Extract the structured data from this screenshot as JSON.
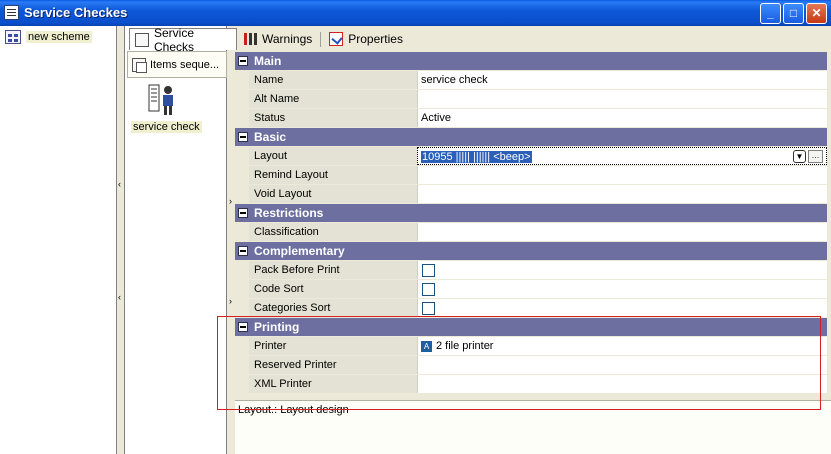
{
  "window": {
    "title": "Service Checkes",
    "buttons": {
      "minimize": "_",
      "maximize": "□",
      "close": "✕"
    }
  },
  "left_tree": {
    "items": [
      {
        "label": "new scheme"
      }
    ]
  },
  "middle": {
    "tab_service_checks": "Service Checks",
    "tab_items_sequence": "Items seque...",
    "item_label": "service check"
  },
  "tabs": {
    "warnings": "Warnings",
    "properties": "Properties"
  },
  "grid": {
    "main": {
      "title": "Main",
      "name_label": "Name",
      "name_value": "service check",
      "altname_label": "Alt Name",
      "altname_value": "",
      "status_label": "Status",
      "status_value": "Active"
    },
    "basic": {
      "title": "Basic",
      "layout_label": "Layout",
      "layout_value": "10955 ||||| |||||| <beep>",
      "remind_label": "Remind Layout",
      "remind_value": "",
      "void_label": "Void Layout",
      "void_value": ""
    },
    "restrictions": {
      "title": "Restrictions",
      "classification_label": "Classification",
      "classification_value": ""
    },
    "complementary": {
      "title": "Complementary",
      "pack_label": "Pack Before Print",
      "pack_checked": false,
      "code_label": "Code Sort",
      "code_checked": false,
      "categories_label": "Categories Sort",
      "categories_checked": false
    },
    "printing": {
      "title": "Printing",
      "printer_label": "Printer",
      "printer_badge": "A",
      "printer_value": "2 file printer",
      "reserved_label": "Reserved Printer",
      "reserved_value": "",
      "xml_label": "XML Printer",
      "xml_value": ""
    }
  },
  "description": {
    "text": "Layout.: Layout design"
  },
  "colors": {
    "titlebar": "#0A4FCC",
    "category_header": "#6C6FA0",
    "highlight_box": "#D42020",
    "selection": "#2B5FB8"
  }
}
